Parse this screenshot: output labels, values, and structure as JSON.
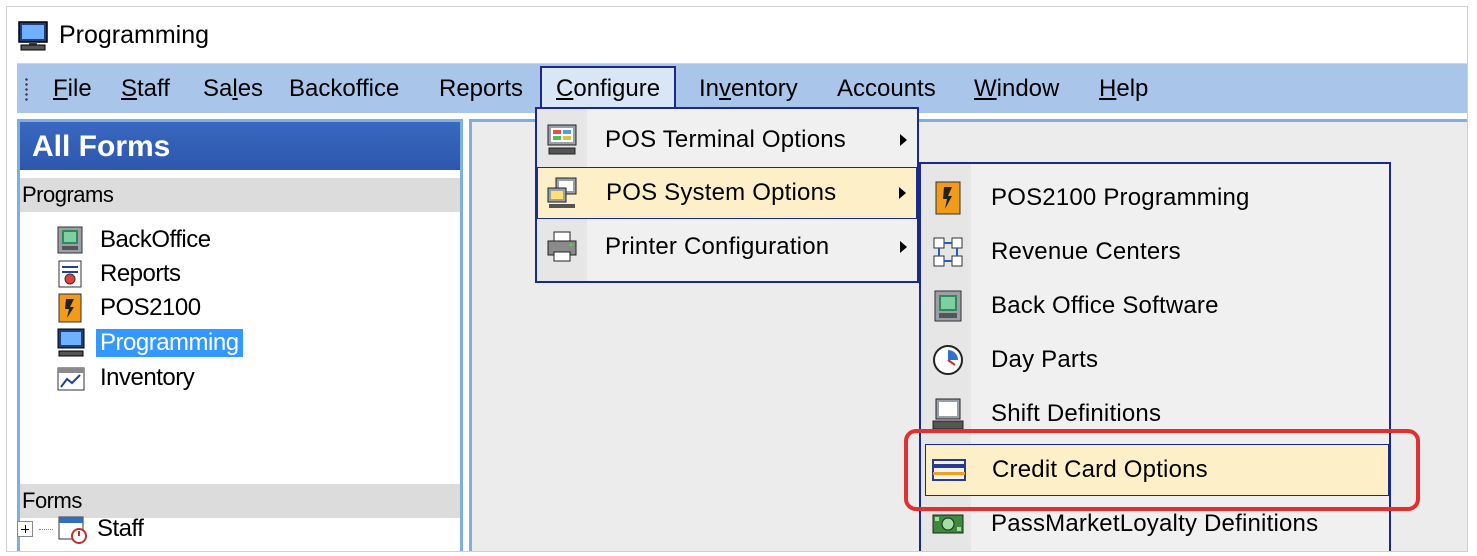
{
  "window": {
    "title": "Programming",
    "icon": "monitor-icon"
  },
  "menubar": {
    "items": [
      {
        "label": "File",
        "mnemonic": "F"
      },
      {
        "label": "Staff",
        "mnemonic": "S"
      },
      {
        "label": "Sales",
        "mnemonic": "l"
      },
      {
        "label": "Backoffice",
        "mnemonic": ""
      },
      {
        "label": "Reports",
        "mnemonic": ""
      },
      {
        "label": "Configure",
        "mnemonic": "C",
        "open": true
      },
      {
        "label": "Inventory",
        "mnemonic": "v"
      },
      {
        "label": "Accounts",
        "mnemonic": ""
      },
      {
        "label": "Window",
        "mnemonic": "W"
      },
      {
        "label": "Help",
        "mnemonic": "H"
      }
    ]
  },
  "leftpane": {
    "header": "All Forms",
    "programs_label": "Programs",
    "programs": [
      {
        "label": "BackOffice",
        "icon": "backoffice-icon"
      },
      {
        "label": "Reports",
        "icon": "reports-icon"
      },
      {
        "label": "POS2100",
        "icon": "pos2100-icon"
      },
      {
        "label": "Programming",
        "icon": "monitor-icon",
        "selected": true
      },
      {
        "label": "Inventory",
        "icon": "inventory-icon"
      }
    ],
    "forms_label": "Forms",
    "forms": [
      {
        "label": "Staff",
        "icon": "staff-icon"
      }
    ]
  },
  "configure_menu": {
    "items": [
      {
        "label": "POS Terminal Options",
        "icon": "terminal-icon",
        "submenu": true
      },
      {
        "label": "POS System Options",
        "icon": "system-icon",
        "submenu": true,
        "highlighted": true
      },
      {
        "label": "Printer Configuration",
        "icon": "printer-icon",
        "submenu": true
      }
    ]
  },
  "system_options_menu": {
    "items": [
      {
        "label": "POS2100 Programming",
        "icon": "pos2100-icon"
      },
      {
        "label": "Revenue Centers",
        "icon": "revenue-centers-icon"
      },
      {
        "label": "Back Office Software",
        "icon": "backoffice-icon"
      },
      {
        "label": "Day Parts",
        "icon": "clock-icon"
      },
      {
        "label": "Shift Definitions",
        "icon": "shift-icon"
      },
      {
        "label": "Credit Card Options",
        "icon": "credit-card-icon",
        "highlighted": true
      },
      {
        "label": "PassMarketLoyalty Definitions",
        "icon": "loyalty-icon"
      }
    ]
  },
  "colors": {
    "menubar_bg": "#a9c6ea",
    "pane_header_bg": "#2c57ad",
    "highlight_bg": "#fdf0c8",
    "menu_border": "#1a2a8c",
    "callout": "#e03030",
    "selection": "#3399ff"
  }
}
